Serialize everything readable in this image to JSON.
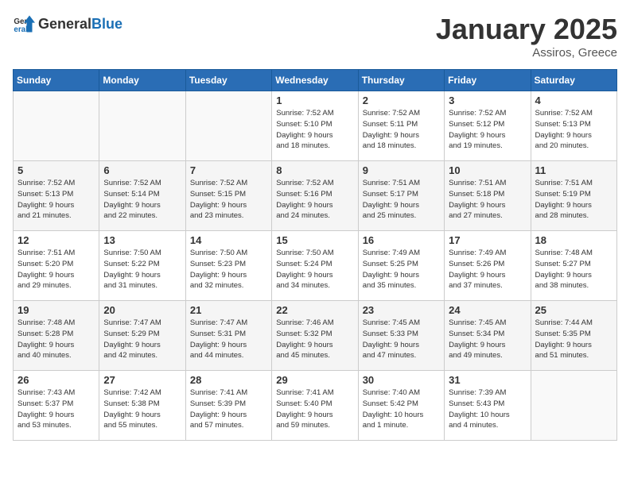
{
  "logo": {
    "general": "General",
    "blue": "Blue"
  },
  "title": "January 2025",
  "subtitle": "Assiros, Greece",
  "weekdays": [
    "Sunday",
    "Monday",
    "Tuesday",
    "Wednesday",
    "Thursday",
    "Friday",
    "Saturday"
  ],
  "rows": [
    [
      {
        "day": "",
        "info": ""
      },
      {
        "day": "",
        "info": ""
      },
      {
        "day": "",
        "info": ""
      },
      {
        "day": "1",
        "info": "Sunrise: 7:52 AM\nSunset: 5:10 PM\nDaylight: 9 hours\nand 18 minutes."
      },
      {
        "day": "2",
        "info": "Sunrise: 7:52 AM\nSunset: 5:11 PM\nDaylight: 9 hours\nand 18 minutes."
      },
      {
        "day": "3",
        "info": "Sunrise: 7:52 AM\nSunset: 5:12 PM\nDaylight: 9 hours\nand 19 minutes."
      },
      {
        "day": "4",
        "info": "Sunrise: 7:52 AM\nSunset: 5:13 PM\nDaylight: 9 hours\nand 20 minutes."
      }
    ],
    [
      {
        "day": "5",
        "info": "Sunrise: 7:52 AM\nSunset: 5:13 PM\nDaylight: 9 hours\nand 21 minutes."
      },
      {
        "day": "6",
        "info": "Sunrise: 7:52 AM\nSunset: 5:14 PM\nDaylight: 9 hours\nand 22 minutes."
      },
      {
        "day": "7",
        "info": "Sunrise: 7:52 AM\nSunset: 5:15 PM\nDaylight: 9 hours\nand 23 minutes."
      },
      {
        "day": "8",
        "info": "Sunrise: 7:52 AM\nSunset: 5:16 PM\nDaylight: 9 hours\nand 24 minutes."
      },
      {
        "day": "9",
        "info": "Sunrise: 7:51 AM\nSunset: 5:17 PM\nDaylight: 9 hours\nand 25 minutes."
      },
      {
        "day": "10",
        "info": "Sunrise: 7:51 AM\nSunset: 5:18 PM\nDaylight: 9 hours\nand 27 minutes."
      },
      {
        "day": "11",
        "info": "Sunrise: 7:51 AM\nSunset: 5:19 PM\nDaylight: 9 hours\nand 28 minutes."
      }
    ],
    [
      {
        "day": "12",
        "info": "Sunrise: 7:51 AM\nSunset: 5:20 PM\nDaylight: 9 hours\nand 29 minutes."
      },
      {
        "day": "13",
        "info": "Sunrise: 7:50 AM\nSunset: 5:22 PM\nDaylight: 9 hours\nand 31 minutes."
      },
      {
        "day": "14",
        "info": "Sunrise: 7:50 AM\nSunset: 5:23 PM\nDaylight: 9 hours\nand 32 minutes."
      },
      {
        "day": "15",
        "info": "Sunrise: 7:50 AM\nSunset: 5:24 PM\nDaylight: 9 hours\nand 34 minutes."
      },
      {
        "day": "16",
        "info": "Sunrise: 7:49 AM\nSunset: 5:25 PM\nDaylight: 9 hours\nand 35 minutes."
      },
      {
        "day": "17",
        "info": "Sunrise: 7:49 AM\nSunset: 5:26 PM\nDaylight: 9 hours\nand 37 minutes."
      },
      {
        "day": "18",
        "info": "Sunrise: 7:48 AM\nSunset: 5:27 PM\nDaylight: 9 hours\nand 38 minutes."
      }
    ],
    [
      {
        "day": "19",
        "info": "Sunrise: 7:48 AM\nSunset: 5:28 PM\nDaylight: 9 hours\nand 40 minutes."
      },
      {
        "day": "20",
        "info": "Sunrise: 7:47 AM\nSunset: 5:29 PM\nDaylight: 9 hours\nand 42 minutes."
      },
      {
        "day": "21",
        "info": "Sunrise: 7:47 AM\nSunset: 5:31 PM\nDaylight: 9 hours\nand 44 minutes."
      },
      {
        "day": "22",
        "info": "Sunrise: 7:46 AM\nSunset: 5:32 PM\nDaylight: 9 hours\nand 45 minutes."
      },
      {
        "day": "23",
        "info": "Sunrise: 7:45 AM\nSunset: 5:33 PM\nDaylight: 9 hours\nand 47 minutes."
      },
      {
        "day": "24",
        "info": "Sunrise: 7:45 AM\nSunset: 5:34 PM\nDaylight: 9 hours\nand 49 minutes."
      },
      {
        "day": "25",
        "info": "Sunrise: 7:44 AM\nSunset: 5:35 PM\nDaylight: 9 hours\nand 51 minutes."
      }
    ],
    [
      {
        "day": "26",
        "info": "Sunrise: 7:43 AM\nSunset: 5:37 PM\nDaylight: 9 hours\nand 53 minutes."
      },
      {
        "day": "27",
        "info": "Sunrise: 7:42 AM\nSunset: 5:38 PM\nDaylight: 9 hours\nand 55 minutes."
      },
      {
        "day": "28",
        "info": "Sunrise: 7:41 AM\nSunset: 5:39 PM\nDaylight: 9 hours\nand 57 minutes."
      },
      {
        "day": "29",
        "info": "Sunrise: 7:41 AM\nSunset: 5:40 PM\nDaylight: 9 hours\nand 59 minutes."
      },
      {
        "day": "30",
        "info": "Sunrise: 7:40 AM\nSunset: 5:42 PM\nDaylight: 10 hours\nand 1 minute."
      },
      {
        "day": "31",
        "info": "Sunrise: 7:39 AM\nSunset: 5:43 PM\nDaylight: 10 hours\nand 4 minutes."
      },
      {
        "day": "",
        "info": ""
      }
    ]
  ]
}
